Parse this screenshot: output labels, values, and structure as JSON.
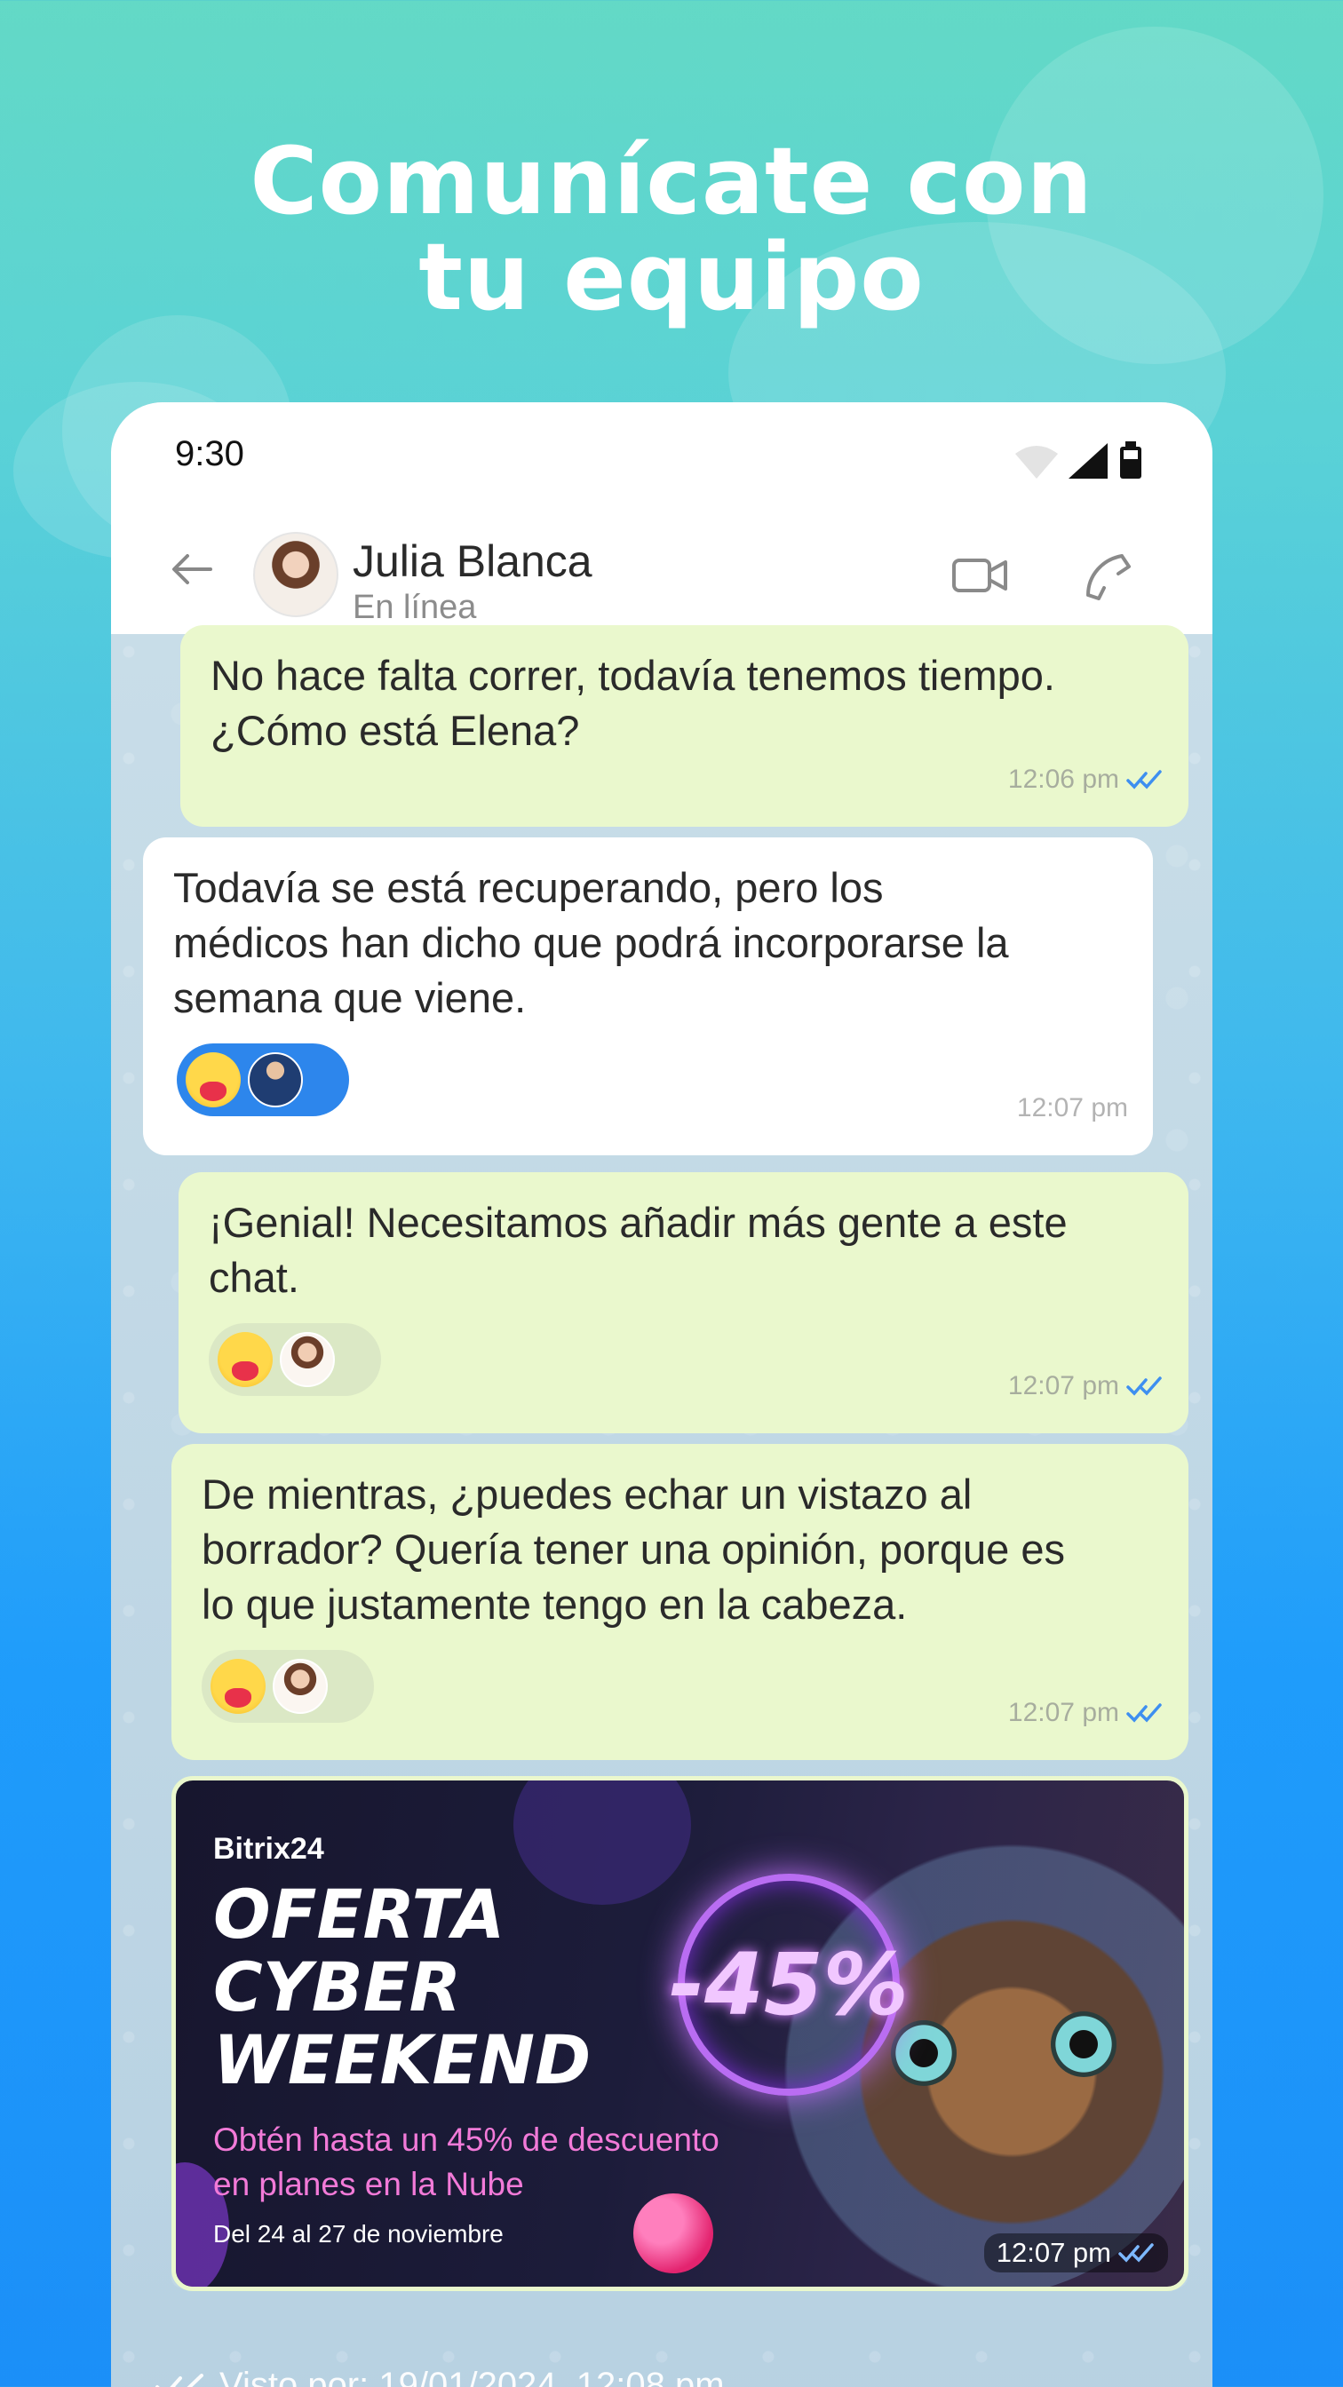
{
  "headline": {
    "line1": "Comunícate con",
    "line2": "tu equipo"
  },
  "status_bar": {
    "time": "9:30"
  },
  "chat_header": {
    "name": "Julia Blanca",
    "status": "En línea"
  },
  "messages": [
    {
      "direction": "out",
      "text": "No hace falta correr, todavía tenemos tiempo.\n¿Cómo está Elena?",
      "time": "12:06 pm",
      "read": true
    },
    {
      "direction": "in",
      "text": "Todavía se está recuperando, pero los\nmédicos han dicho que podrá incorporarse la\nsemana que viene.",
      "time": "12:07 pm"
    },
    {
      "direction": "out",
      "text": "¡Genial! Necesitamos añadir más gente a este\nchat.",
      "time": "12:07 pm",
      "read": true
    },
    {
      "direction": "out",
      "text": "De mientras, ¿puedes echar un vistazo al\nborrador? Quería tener una opinión, porque es\nlo que justamente tengo en la cabeza.",
      "time": "12:07 pm",
      "read": true
    }
  ],
  "promo": {
    "brand": "Bitrix24",
    "title_line1": "OFERTA",
    "title_line2": "CYBER",
    "title_line3": "WEEKEND",
    "subtitle_line1": "Obtén hasta un 45% de descuento",
    "subtitle_line2": "en planes en la Nube",
    "dates": "Del 24 al 27 de noviembre",
    "badge": "-45%",
    "time": "12:07 pm"
  },
  "seen": {
    "text": "Visto por: 19/01/2024, 12:08 pm"
  },
  "colors": {
    "outgoing_bubble": "#eaf8cd",
    "incoming_bubble": "#ffffff",
    "read_ticks": "#3e8ff0",
    "reaction_blue": "#2d86ec"
  },
  "icons": {
    "back": "arrow-left-icon",
    "video": "video-camera-icon",
    "call": "phone-icon",
    "wifi": "wifi-icon",
    "signal": "signal-icon",
    "battery": "battery-icon",
    "read": "double-check-icon",
    "reaction": "heart-smile-emoji-icon"
  }
}
